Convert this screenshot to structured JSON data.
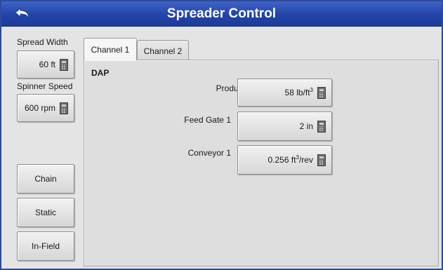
{
  "window": {
    "title": "Spreader Control"
  },
  "icons": {
    "back": "back-arrow-icon",
    "calculator": "calculator-icon"
  },
  "left": {
    "spread_width": {
      "label": "Spread Width",
      "value": "60 ft"
    },
    "spinner_speed": {
      "label": "Spinner Speed",
      "value": "600 rpm"
    },
    "buttons": {
      "chain": "Chain",
      "static": "Static",
      "in_field": "In-Field"
    }
  },
  "tabs": [
    {
      "label": "Channel 1",
      "active": true
    },
    {
      "label": "Channel 2",
      "active": false
    }
  ],
  "channel": {
    "product_name": "DAP",
    "rows": {
      "product": {
        "label": "Product",
        "value": "58 lb/ft",
        "superscript": "3"
      },
      "feed_gate": {
        "label": "Feed Gate 1",
        "value": "2 in"
      },
      "conveyor": {
        "label": "Conveyor 1",
        "value": "0.256 ft",
        "superscript": "3",
        "suffix": "/rev"
      }
    }
  },
  "colors": {
    "title_bar": "#2244a8",
    "title_text": "#ffffff",
    "border": "#2d4a9a"
  }
}
